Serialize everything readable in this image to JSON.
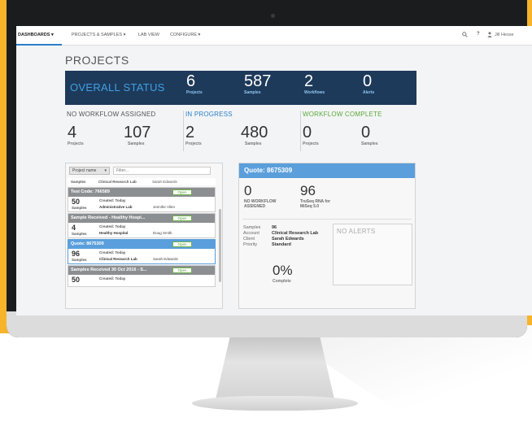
{
  "nav": {
    "dashboards": "DASHBOARDS ▾",
    "projects_samples": "PROJECTS & SAMPLES ▾",
    "lab_view": "LAB VIEW",
    "configure": "CONFIGURE ▾",
    "help": "?",
    "user": "Jill Hesse"
  },
  "page": {
    "title": "PROJECTS"
  },
  "overall": {
    "title": "OVERALL STATUS",
    "stats": [
      {
        "num": "6",
        "label": "Projects"
      },
      {
        "num": "587",
        "label": "Samples"
      },
      {
        "num": "2",
        "label": "Workflows"
      },
      {
        "num": "0",
        "label": "Alerts"
      }
    ]
  },
  "groups": [
    {
      "title": "NO WORKFLOW ASSIGNED",
      "color": "#555555",
      "projects": "4",
      "projects_label": "Projects",
      "samples": "107",
      "samples_label": "Samples"
    },
    {
      "title": "IN PROGRESS",
      "color": "#2a7fc9",
      "projects": "2",
      "projects_label": "Projects",
      "samples": "480",
      "samples_label": "Samples"
    },
    {
      "title": "WORKFLOW COMPLETE",
      "color": "#5aaa3a",
      "projects": "0",
      "projects_label": "Projects",
      "samples": "0",
      "samples_label": "Samples"
    }
  ],
  "list": {
    "filter_select": "Project name",
    "filter_placeholder": "Filter...",
    "top_row": {
      "label": "Samples",
      "account": "Clinical Research Lab",
      "user": "Sarah Edwards"
    },
    "cards": [
      {
        "title": "Test Code: 766589",
        "open": "Open",
        "num": "50",
        "num_label": "Samples",
        "created": "Created: Today",
        "account": "Administrative Lab",
        "user": "Jennifer Allen"
      },
      {
        "title": "Sample Received - Healthy Hospi...",
        "open": "Open",
        "num": "4",
        "num_label": "Samples",
        "created": "Created: Today",
        "account": "Healthy Hospital",
        "user": "Doug Smith"
      },
      {
        "title": "Quote: 8675309",
        "open": "Open",
        "num": "96",
        "num_label": "Samples",
        "created": "Created: Today",
        "account": "Clinical Research Lab",
        "user": "Sarah Edwards"
      },
      {
        "title": "Samples Received 30 Oct 2016 - S...",
        "open": "Open",
        "num": "50",
        "num_label": "",
        "created": "Created: Today",
        "account": "",
        "user": ""
      }
    ]
  },
  "detail": {
    "title": "Quote: 8675309",
    "left_num": "0",
    "left_label_1": "NO WORKFLOW",
    "left_label_2": "ASSIGNED",
    "right_num": "96",
    "right_label_1": "TruSeq RNA for",
    "right_label_2": "MiSeq 5.0",
    "keys": [
      "Samples",
      "Account",
      "Client",
      "Priority"
    ],
    "values": [
      "96",
      "Clinical Research Lab",
      "Sarah Edwards",
      "Standard"
    ],
    "alerts": "NO ALERTS",
    "complete_pct": "0%",
    "complete_label": "Complete"
  }
}
